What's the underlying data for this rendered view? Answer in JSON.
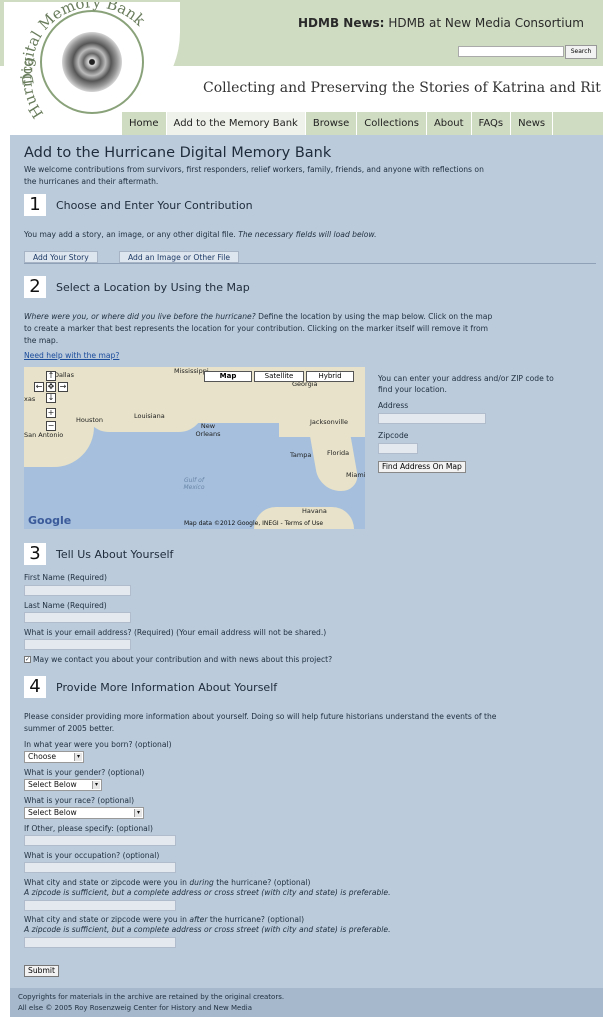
{
  "header": {
    "logo_text": "Hurricane Digital Memory Bank",
    "news_label": "HDMB News:",
    "news_text": "HDMB at New Media Consortium",
    "search_button": "Search",
    "tagline": "Collecting and Preserving the Stories of Katrina and Rit"
  },
  "nav": {
    "tabs": [
      "Home",
      "Add to the Memory Bank",
      "Browse",
      "Collections",
      "About",
      "FAQs",
      "News"
    ],
    "active": "Add to the Memory Bank"
  },
  "page": {
    "title": "Add to the Hurricane Digital Memory Bank",
    "intro_line1": "We welcome contributions from survivors, first responders, relief workers, family, friends, and anyone with reflections on",
    "intro_line2": "the hurricanes and their aftermath."
  },
  "step1": {
    "number": "1",
    "title": "Choose and Enter Your Contribution",
    "desc_prefix": "You may add a story, an image, or any other digital file. ",
    "desc_italic": "The necessary fields will load below.",
    "tab_story": "Add Your Story",
    "tab_file": "Add an Image or Other File"
  },
  "step2": {
    "number": "2",
    "title": "Select a Location by Using the Map",
    "desc_italic": "Where were you, or where did you live before the hurricane?",
    "desc_line1_rest": " Define the location by using the map below. Click on the map",
    "desc_line2": "to create a marker that best represents the location for your contribution. Clicking on the marker itself will remove it from",
    "desc_line3": "the map.",
    "help_link": "Need help with the map?",
    "map_types": [
      "Map",
      "Satellite",
      "Hybrid"
    ],
    "cities": [
      "Dallas",
      "Mississippi",
      "Georgia",
      "Houston",
      "Louisiana",
      "New Orleans",
      "Jacksonville",
      "San Antonio",
      "Tampa",
      "Florida",
      "Gulf of Mexico",
      "Havana",
      "Miami",
      "xas"
    ],
    "map_attribution": "Map data ©2012 Google, INEGI - Terms of Use",
    "google_logo": "Google",
    "address_hint_line1": "You can enter your address and/or ZIP code to",
    "address_hint_line2": "find your location.",
    "address_label": "Address",
    "zipcode_label": "Zipcode",
    "find_button": "Find Address On Map"
  },
  "step3": {
    "number": "3",
    "title": "Tell Us About Yourself",
    "first_name_label": "First Name (Required)",
    "last_name_label": "Last Name (Required)",
    "email_label": "What is your email address? (Required) (Your email address will not be shared.)",
    "contact_label": "May we contact you about your contribution and with news about this project?"
  },
  "step4": {
    "number": "4",
    "title": "Provide More Information About Yourself",
    "desc_line1": "Please consider providing more information about yourself. Doing so will help future historians understand the events of the",
    "desc_line2": "summer of 2005 better.",
    "born_label": "In what year were you born? (optional)",
    "born_value": "Choose",
    "gender_label": "What is your gender? (optional)",
    "gender_value": "Select Below",
    "race_label": "What is your race? (optional)",
    "race_value": "Select Below",
    "other_label": "If Other, please specify: (optional)",
    "occupation_label": "What is your occupation? (optional)",
    "during_label_a": "What city and state or zipcode were you in ",
    "during_label_em": "during",
    "during_label_b": " the hurricane? (optional)",
    "during_hint": "A zipcode is sufficient, but a complete address or cross street (with city and state) is preferable.",
    "after_label_a": "What city and state or zipcode were you in ",
    "after_label_em": "after",
    "after_label_b": " the hurricane? (optional)",
    "after_hint": "A zipcode is sufficient, but a complete address or cross street (with city and state) is preferable.",
    "submit": "Submit"
  },
  "footer": {
    "line1": "Copyrights for materials in the archive are retained by the original creators.",
    "line2": "All else © 2005 Roy Rosenzweig Center for History and New Media"
  },
  "colors": {
    "header_band": "#cfdcc2",
    "content_bg": "#bccbdc",
    "footer_bg": "#a6b8cc",
    "link": "#1a4c9a"
  }
}
